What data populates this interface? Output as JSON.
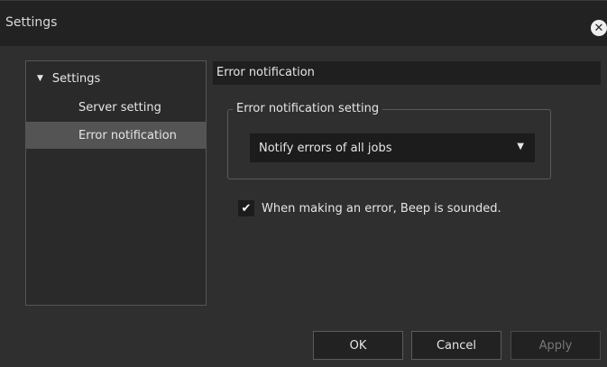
{
  "window": {
    "title": "Settings",
    "close_icon": "close-icon"
  },
  "sidebar": {
    "root_label": "Settings",
    "items": [
      {
        "label": "Server setting",
        "selected": false
      },
      {
        "label": "Error notification",
        "selected": true
      }
    ]
  },
  "main": {
    "header": "Error notification",
    "group_title": "Error notification setting",
    "select_value": "Notify errors of all jobs",
    "checkbox_label": "When making an error, Beep is sounded.",
    "checkbox_checked": true
  },
  "buttons": {
    "ok": "OK",
    "cancel": "Cancel",
    "apply": "Apply"
  },
  "colors": {
    "background": "#2f2f2f",
    "titlebar": "#222222",
    "selected_item": "#545454"
  }
}
